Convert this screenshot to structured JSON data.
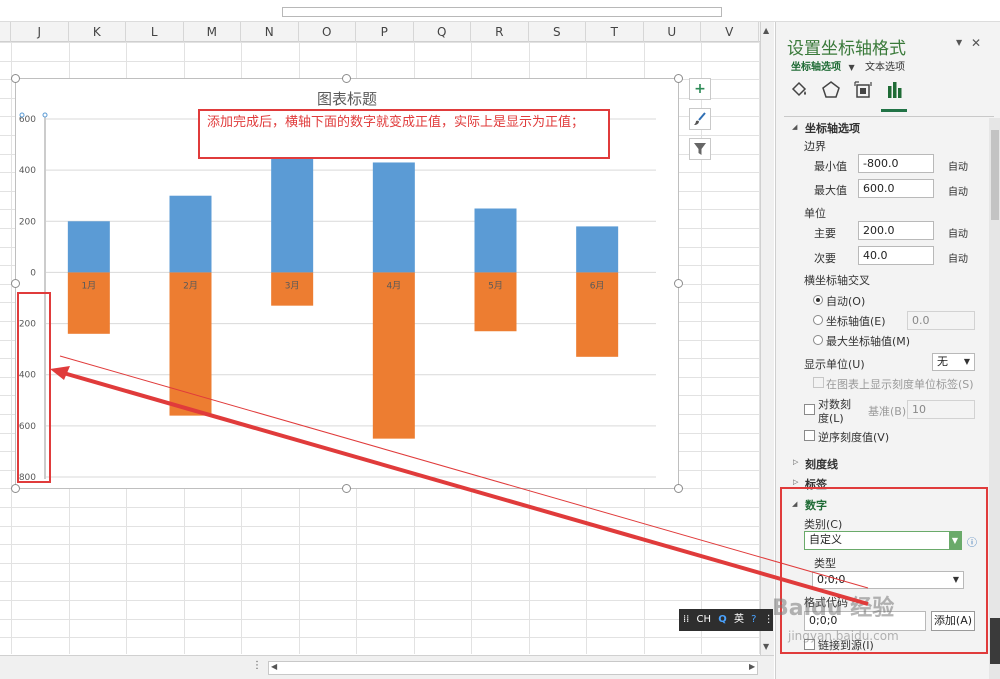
{
  "sheet": {
    "columns": [
      "J",
      "K",
      "L",
      "M",
      "N",
      "O",
      "P",
      "Q",
      "R",
      "S",
      "T",
      "U",
      "V"
    ]
  },
  "chart": {
    "title": "图表标题",
    "annotation": "添加完成后，横轴下面的数字就变成正值，实际上是显示为正值；",
    "side_buttons": {
      "add": "+",
      "style": "brush",
      "filter": "filter"
    }
  },
  "chart_data": {
    "type": "bar",
    "categories": [
      "1月",
      "2月",
      "3月",
      "4月",
      "5月",
      "6月"
    ],
    "series": [
      {
        "values": [
          200,
          300,
          500,
          430,
          250,
          180
        ],
        "color": "#5b9bd5"
      },
      {
        "values": [
          -240,
          -560,
          -130,
          -650,
          -230,
          -330
        ],
        "color": "#ed7d31"
      }
    ],
    "y_ticks": [
      {
        "value": 600,
        "label": "600"
      },
      {
        "value": 400,
        "label": "400"
      },
      {
        "value": 200,
        "label": "200"
      },
      {
        "value": 0,
        "label": "0"
      },
      {
        "value": -200,
        "label": "200"
      },
      {
        "value": -400,
        "label": "400"
      },
      {
        "value": -600,
        "label": "600"
      },
      {
        "value": -800,
        "label": "800"
      }
    ],
    "ylim": [
      -800,
      600
    ],
    "grid": true,
    "stacked": true
  },
  "pane": {
    "title": "设置坐标轴格式",
    "tab_axis": "坐标轴选项",
    "tab_text": "文本选项",
    "icons": [
      "paint-bucket-icon",
      "pentagon-icon",
      "size-properties-icon",
      "bar-chart-icon"
    ],
    "section_axis": "坐标轴选项",
    "bounds_label": "边界",
    "min_label": "最小值",
    "min_value": "-800.0",
    "max_label": "最大值",
    "max_value": "600.0",
    "auto": "自动",
    "units_label": "单位",
    "major_label": "主要",
    "major_value": "200.0",
    "minor_label": "次要",
    "minor_value": "40.0",
    "cross_label": "横坐标轴交叉",
    "cross_auto": "自动(O)",
    "cross_value_label": "坐标轴值(E)",
    "cross_value": "0.0",
    "cross_max": "最大坐标轴值(M)",
    "display_units_label": "显示单位(U)",
    "display_units_value": "无",
    "show_units_label": "在图表上显示刻度单位标签(S)",
    "log_label_1": "对数刻",
    "log_label_2": "度(L)",
    "log_base_label": "基准(B)",
    "log_base_value": "10",
    "reverse_label": "逆序刻度值(V)",
    "section_ticks": "刻度线",
    "section_labels": "标签",
    "section_number": "数字",
    "category_label": "类别(C)",
    "category_value": "自定义",
    "type_label": "类型",
    "type_value": "0;0;0",
    "format_code_label": "格式代码",
    "format_code_value": "0;0;0",
    "add_button": "添加(A)",
    "link_source": "链接到源(I)"
  },
  "ime": {
    "items": [
      "CH",
      "英"
    ]
  },
  "watermark": {
    "main": "Baidu 经验",
    "sub": "jingyan.baidu.com"
  }
}
